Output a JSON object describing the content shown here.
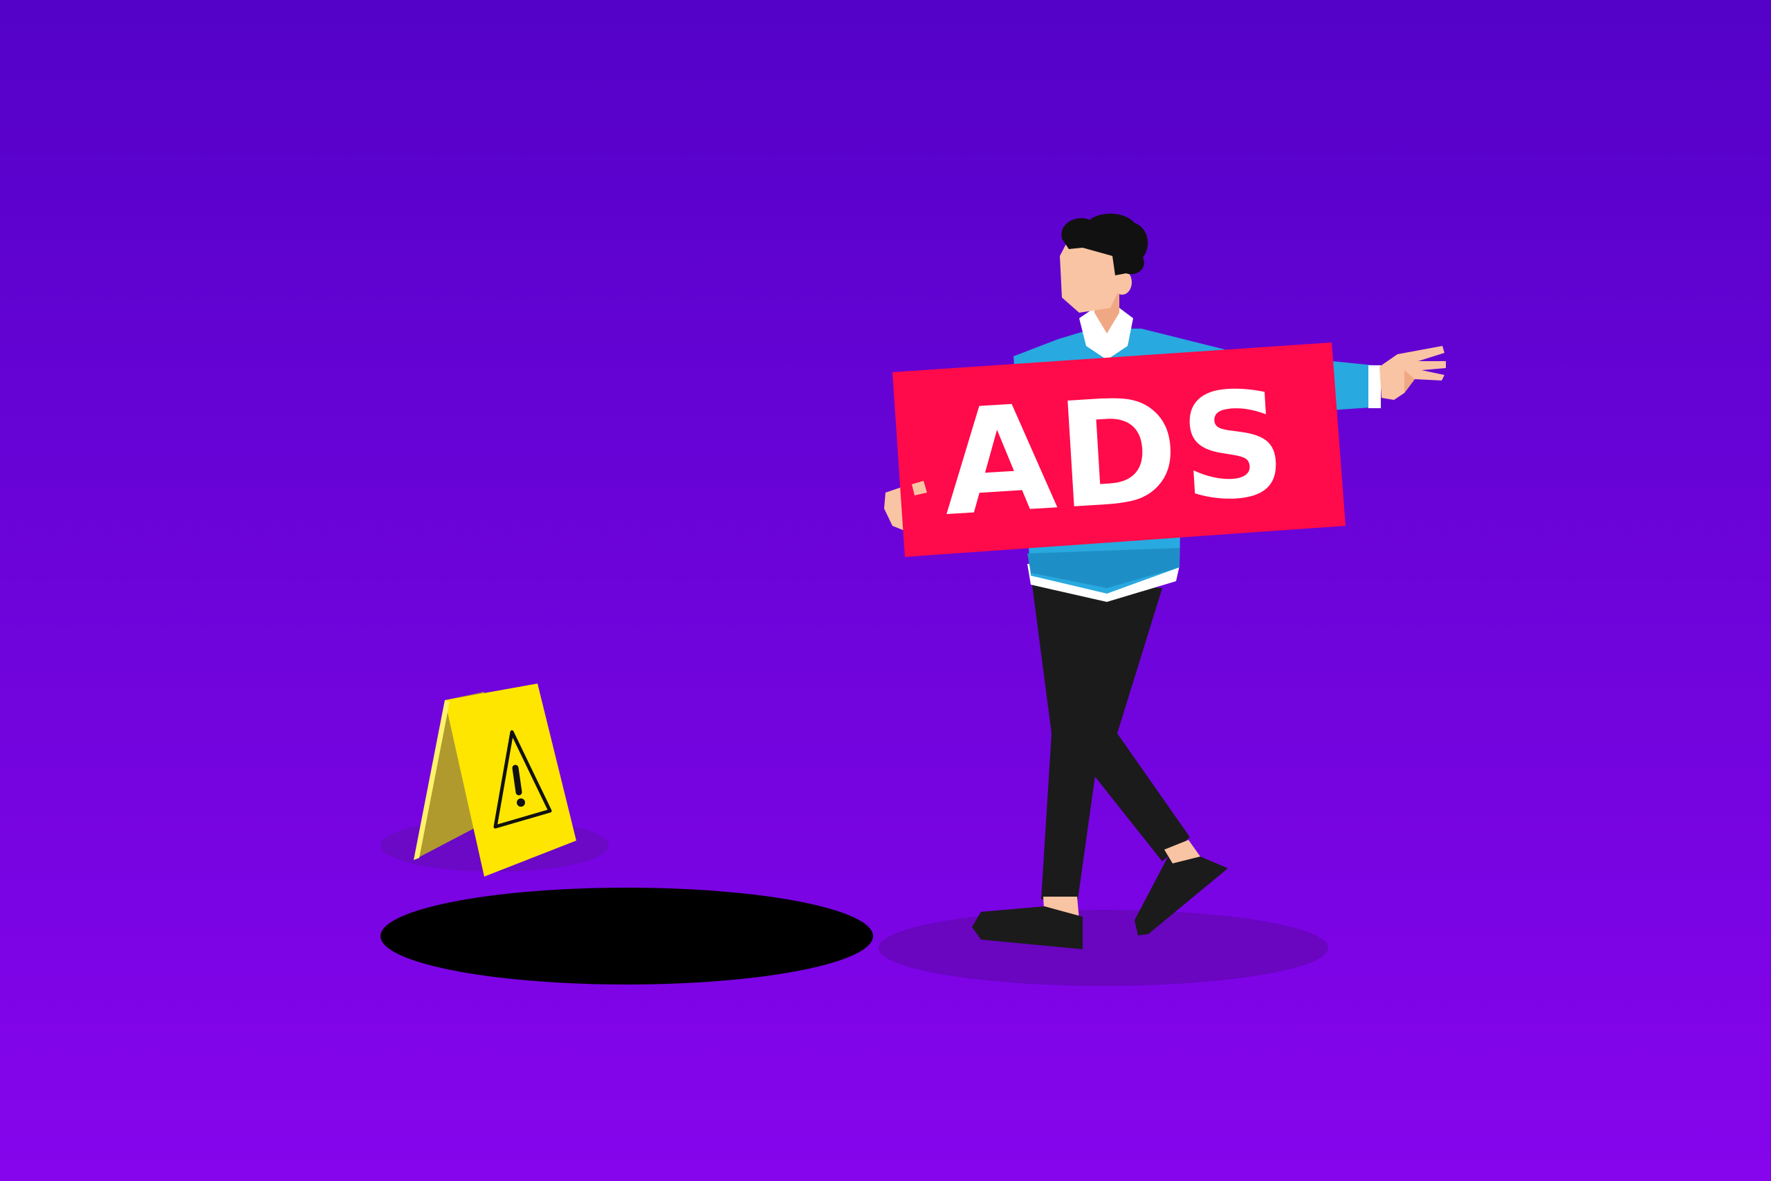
{
  "sign": {
    "text": "ADS"
  },
  "colors": {
    "background_top": "#5402C8",
    "background_bottom": "#8605EC",
    "sign_red": "#FF0A4A",
    "sweater_blue": "#28A9DF",
    "sweater_shadow": "#1E8FC6",
    "pants_black": "#1B1B1B",
    "skin": "#F9C4A3",
    "skin_shadow": "#F0A884",
    "hair": "#111111",
    "shirt_white": "#FFFFFF",
    "caution_yellow": "#FFE600",
    "caution_yellow_dark": "#B09A2E",
    "hole_black": "#000000",
    "ground_shadow": "#6A05C0",
    "sign_shadow": "#6B09C6"
  },
  "icons": {
    "warning": "warning-triangle-icon"
  }
}
